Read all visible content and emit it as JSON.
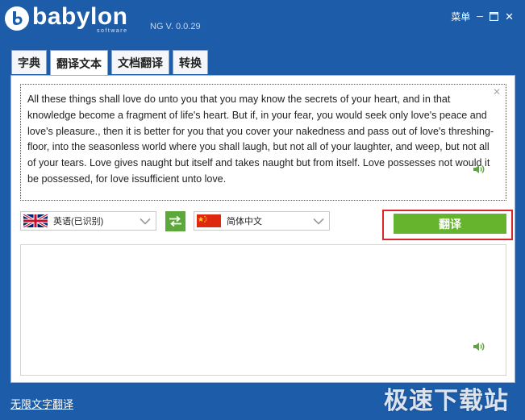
{
  "app": {
    "logo_word": "babylon",
    "logo_sub": "software",
    "version": "NG V. 0.0.29"
  },
  "window": {
    "menu_label": "菜单",
    "minimize_glyph": "─",
    "close_glyph": "✕"
  },
  "tabs": [
    {
      "label": "字典",
      "active": false
    },
    {
      "label": "翻译文本",
      "active": true
    },
    {
      "label": "文档翻译",
      "active": false
    },
    {
      "label": "转换",
      "active": false
    }
  ],
  "source": {
    "text": "All these things shall love do unto you that you may know the secrets of your heart, and in that knowledge become a fragment of life's heart. But if, in your fear, you would seek only love's peace and love's pleasure., then it is better for you that you cover your nakedness and pass out of love's threshing-floor, into the seasonless world where you shall laugh, but not all of your laughter, and weep, but not all of your tears. Love gives naught but itself and takes naught but from itself. Love possesses not would it be possessed, for love issufficient unto love.",
    "clear_glyph": "✕"
  },
  "languages": {
    "source_label": "英语(已识别)",
    "target_label": "简体中文"
  },
  "translate_label": "翻译",
  "bottom_link": "无限文字翻译",
  "watermark": "极速下载站",
  "colors": {
    "background": "#1d5ca8",
    "accent_green": "#66b32e",
    "highlight_red": "#d9262a"
  },
  "icons": {
    "speaker": "speaker-icon",
    "swap": "swap-icon",
    "dropdown": "chevron-down-icon"
  }
}
